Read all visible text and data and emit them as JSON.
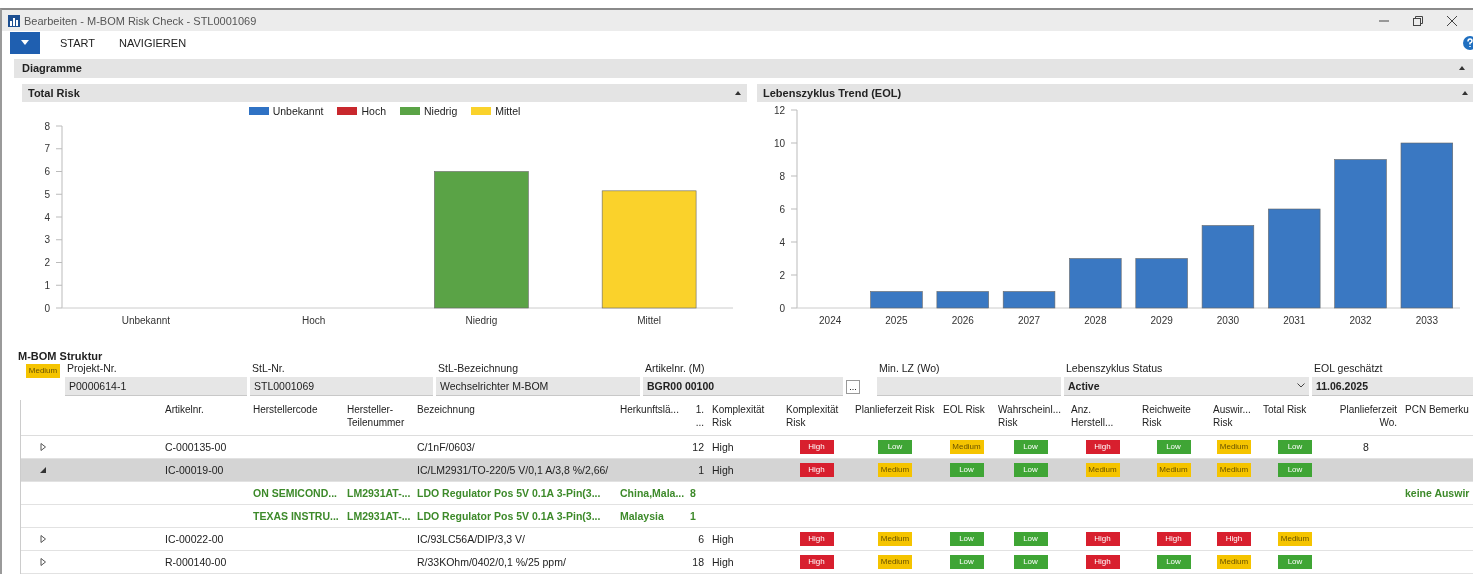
{
  "window": {
    "title": "Bearbeiten - M-BOM Risk Check - STL0001069"
  },
  "menu": {
    "tabs": [
      {
        "label": "START",
        "selected": false
      },
      {
        "label": "NAVIGIEREN",
        "selected": false
      }
    ]
  },
  "section": {
    "title": "Diagramme"
  },
  "charts": [
    {
      "title": "Total Risk",
      "chart_data": {
        "type": "bar",
        "stacked": true,
        "categories": [
          "Unbekannt",
          "Hoch",
          "Niedrig",
          "Mittel"
        ],
        "ylim": [
          0,
          8
        ],
        "yticks": [
          0,
          1,
          2,
          3,
          4,
          5,
          6,
          7,
          8
        ],
        "series": [
          {
            "name": "Unbekannt",
            "color": "#2f72c4",
            "values": [
              0,
              null,
              null,
              null
            ]
          },
          {
            "name": "Hoch",
            "color": "#c8282d",
            "values": [
              null,
              0,
              null,
              null
            ]
          },
          {
            "name": "Niedrig",
            "color": "#5aa346",
            "values": [
              null,
              null,
              6,
              null
            ]
          },
          {
            "name": "Mittel",
            "color": "#fad22b",
            "values": [
              null,
              null,
              null,
              5.15
            ]
          }
        ]
      }
    },
    {
      "title": "Lebenszyklus Trend (EOL)",
      "chart_data": {
        "type": "bar",
        "categories": [
          "2024",
          "2025",
          "2026",
          "2027",
          "2028",
          "2029",
          "2030",
          "2031",
          "2032",
          "2033"
        ],
        "ylim": [
          0,
          12
        ],
        "yticks": [
          0,
          2,
          4,
          6,
          8,
          10,
          12
        ],
        "series": [
          {
            "color": "#3a78c2",
            "values": [
              0,
              1,
              1,
              1,
              3,
              3,
              5,
              6,
              9,
              10
            ]
          }
        ]
      }
    }
  ],
  "structure": {
    "title": "M-BOM Struktur",
    "status_badge": {
      "kind": "medium",
      "label": "Medium"
    },
    "fields": [
      {
        "label": "Projekt-Nr.",
        "value": "P0000614-1",
        "kind": "text"
      },
      {
        "label": "StL-Nr.",
        "value": "STL0001069",
        "kind": "text"
      },
      {
        "label": "StL-Bezeichnung",
        "value": "Wechselrichter M-BOM",
        "kind": "text"
      },
      {
        "label": "Artikelnr. (M)",
        "value": "BGR00 00100",
        "kind": "lookup",
        "button": "..."
      },
      {
        "label": "Min. LZ (Wo)",
        "kind": "text"
      },
      {
        "label": "Lebenszyklus Status",
        "value": "Active",
        "kind": "dropdown"
      },
      {
        "label": "EOL geschätzt",
        "value": "11.06.2025",
        "kind": "bold"
      }
    ]
  },
  "table": {
    "columns": [
      "Artikelnr.",
      "Herstellercode",
      "Hersteller-Teilenummer",
      "Bezeichnung",
      "Herkunftslä...",
      "1. ...",
      "Komplexität Risk",
      "Komplexität Risk",
      "Planlieferzeit Risk",
      "EOL Risk",
      "Wahrscheinl... Risk",
      "Anz. Herstell...",
      "Reichweite Risk",
      "Auswir... Risk",
      "Total Risk",
      "Planlieferzeit Wo.",
      "PCN Bemerku"
    ],
    "rows": [
      {
        "expanded": false,
        "selected": false,
        "artikelnr": "C-000135-00",
        "bezeichnung": "C/1nF/0603/",
        "qty": "12",
        "komplexitaet": "High",
        "planlieferzeit_wo": "8",
        "badges": [
          {
            "kind": "high",
            "label": "High"
          },
          {
            "kind": "low",
            "label": "Low"
          },
          {
            "kind": "medium",
            "label": "Medium"
          },
          {
            "kind": "low",
            "label": "Low"
          },
          {
            "kind": "high",
            "label": "High"
          },
          {
            "kind": "low",
            "label": "Low"
          },
          {
            "kind": "medium",
            "label": "Medium"
          },
          {
            "kind": "low",
            "label": "Low"
          }
        ]
      },
      {
        "expanded": true,
        "selected": true,
        "artikelnr": "IC-00019-00",
        "bezeichnung": "IC/LM2931/TO-220/5 V/0,1 A/3,8 %/2,66/",
        "qty": "1",
        "komplexitaet": "High",
        "badges": [
          {
            "kind": "high",
            "label": "High"
          },
          {
            "kind": "medium",
            "label": "Medium"
          },
          {
            "kind": "low",
            "label": "Low"
          },
          {
            "kind": "low",
            "label": "Low"
          },
          {
            "kind": "medium",
            "label": "Medium"
          },
          {
            "kind": "medium",
            "label": "Medium"
          },
          {
            "kind": "medium",
            "label": "Medium"
          },
          {
            "kind": "low",
            "label": "Low"
          }
        ],
        "children": [
          {
            "herstellercode": "ON SEMICOND...",
            "teilenummer": "LM2931AT-...",
            "bezeichnung": "LDO Regulator Pos 5V 0.1A 3-Pin(3...",
            "herkunft": "China,Mala...",
            "qty": "8",
            "pcn": "keine Auswir"
          },
          {
            "herstellercode": "TEXAS INSTRU...",
            "teilenummer": "LM2931AT-...",
            "bezeichnung": "LDO Regulator Pos 5V 0.1A 3-Pin(3...",
            "herkunft": "Malaysia",
            "qty": "1"
          }
        ]
      },
      {
        "expanded": false,
        "selected": false,
        "artikelnr": "IC-00022-00",
        "bezeichnung": "IC/93LC56A/DIP/3,3 V/",
        "qty": "6",
        "komplexitaet": "High",
        "badges": [
          {
            "kind": "high",
            "label": "High"
          },
          {
            "kind": "medium",
            "label": "Medium"
          },
          {
            "kind": "low",
            "label": "Low"
          },
          {
            "kind": "low",
            "label": "Low"
          },
          {
            "kind": "high",
            "label": "High"
          },
          {
            "kind": "high",
            "label": "High"
          },
          {
            "kind": "high",
            "label": "High"
          },
          {
            "kind": "medium",
            "label": "Medium"
          }
        ]
      },
      {
        "expanded": false,
        "selected": false,
        "artikelnr": "R-000140-00",
        "bezeichnung": "R/33KOhm/0402/0,1 %/25 ppm/",
        "qty": "18",
        "komplexitaet": "High",
        "badges": [
          {
            "kind": "high",
            "label": "High"
          },
          {
            "kind": "medium",
            "label": "Medium"
          },
          {
            "kind": "low",
            "label": "Low"
          },
          {
            "kind": "low",
            "label": "Low"
          },
          {
            "kind": "high",
            "label": "High"
          },
          {
            "kind": "low",
            "label": "Low"
          },
          {
            "kind": "medium",
            "label": "Medium"
          },
          {
            "kind": "low",
            "label": "Low"
          }
        ]
      }
    ]
  }
}
